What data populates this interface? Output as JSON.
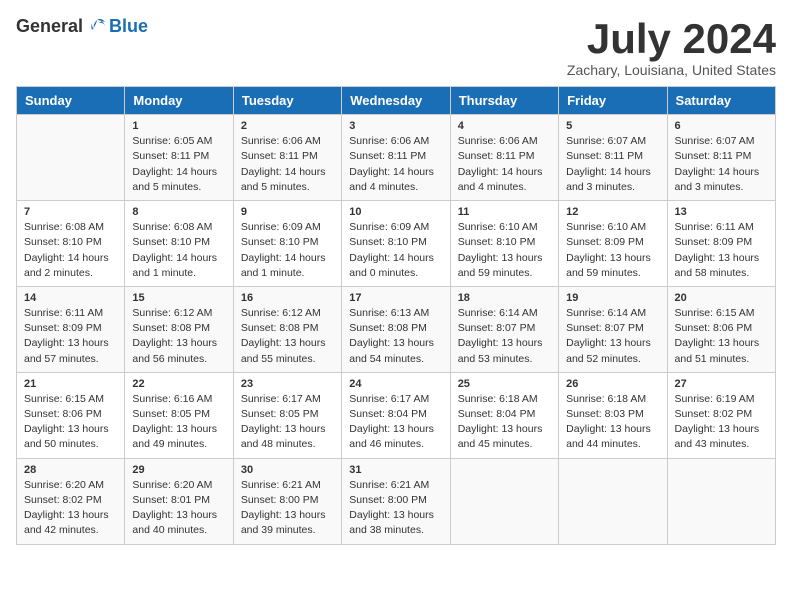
{
  "header": {
    "logo_general": "General",
    "logo_blue": "Blue",
    "month_title": "July 2024",
    "subtitle": "Zachary, Louisiana, United States"
  },
  "calendar": {
    "days_of_week": [
      "Sunday",
      "Monday",
      "Tuesday",
      "Wednesday",
      "Thursday",
      "Friday",
      "Saturday"
    ],
    "weeks": [
      [
        {
          "day": "",
          "info": ""
        },
        {
          "day": "1",
          "info": "Sunrise: 6:05 AM\nSunset: 8:11 PM\nDaylight: 14 hours\nand 5 minutes."
        },
        {
          "day": "2",
          "info": "Sunrise: 6:06 AM\nSunset: 8:11 PM\nDaylight: 14 hours\nand 5 minutes."
        },
        {
          "day": "3",
          "info": "Sunrise: 6:06 AM\nSunset: 8:11 PM\nDaylight: 14 hours\nand 4 minutes."
        },
        {
          "day": "4",
          "info": "Sunrise: 6:06 AM\nSunset: 8:11 PM\nDaylight: 14 hours\nand 4 minutes."
        },
        {
          "day": "5",
          "info": "Sunrise: 6:07 AM\nSunset: 8:11 PM\nDaylight: 14 hours\nand 3 minutes."
        },
        {
          "day": "6",
          "info": "Sunrise: 6:07 AM\nSunset: 8:11 PM\nDaylight: 14 hours\nand 3 minutes."
        }
      ],
      [
        {
          "day": "7",
          "info": "Sunrise: 6:08 AM\nSunset: 8:10 PM\nDaylight: 14 hours\nand 2 minutes."
        },
        {
          "day": "8",
          "info": "Sunrise: 6:08 AM\nSunset: 8:10 PM\nDaylight: 14 hours\nand 1 minute."
        },
        {
          "day": "9",
          "info": "Sunrise: 6:09 AM\nSunset: 8:10 PM\nDaylight: 14 hours\nand 1 minute."
        },
        {
          "day": "10",
          "info": "Sunrise: 6:09 AM\nSunset: 8:10 PM\nDaylight: 14 hours\nand 0 minutes."
        },
        {
          "day": "11",
          "info": "Sunrise: 6:10 AM\nSunset: 8:10 PM\nDaylight: 13 hours\nand 59 minutes."
        },
        {
          "day": "12",
          "info": "Sunrise: 6:10 AM\nSunset: 8:09 PM\nDaylight: 13 hours\nand 59 minutes."
        },
        {
          "day": "13",
          "info": "Sunrise: 6:11 AM\nSunset: 8:09 PM\nDaylight: 13 hours\nand 58 minutes."
        }
      ],
      [
        {
          "day": "14",
          "info": "Sunrise: 6:11 AM\nSunset: 8:09 PM\nDaylight: 13 hours\nand 57 minutes."
        },
        {
          "day": "15",
          "info": "Sunrise: 6:12 AM\nSunset: 8:08 PM\nDaylight: 13 hours\nand 56 minutes."
        },
        {
          "day": "16",
          "info": "Sunrise: 6:12 AM\nSunset: 8:08 PM\nDaylight: 13 hours\nand 55 minutes."
        },
        {
          "day": "17",
          "info": "Sunrise: 6:13 AM\nSunset: 8:08 PM\nDaylight: 13 hours\nand 54 minutes."
        },
        {
          "day": "18",
          "info": "Sunrise: 6:14 AM\nSunset: 8:07 PM\nDaylight: 13 hours\nand 53 minutes."
        },
        {
          "day": "19",
          "info": "Sunrise: 6:14 AM\nSunset: 8:07 PM\nDaylight: 13 hours\nand 52 minutes."
        },
        {
          "day": "20",
          "info": "Sunrise: 6:15 AM\nSunset: 8:06 PM\nDaylight: 13 hours\nand 51 minutes."
        }
      ],
      [
        {
          "day": "21",
          "info": "Sunrise: 6:15 AM\nSunset: 8:06 PM\nDaylight: 13 hours\nand 50 minutes."
        },
        {
          "day": "22",
          "info": "Sunrise: 6:16 AM\nSunset: 8:05 PM\nDaylight: 13 hours\nand 49 minutes."
        },
        {
          "day": "23",
          "info": "Sunrise: 6:17 AM\nSunset: 8:05 PM\nDaylight: 13 hours\nand 48 minutes."
        },
        {
          "day": "24",
          "info": "Sunrise: 6:17 AM\nSunset: 8:04 PM\nDaylight: 13 hours\nand 46 minutes."
        },
        {
          "day": "25",
          "info": "Sunrise: 6:18 AM\nSunset: 8:04 PM\nDaylight: 13 hours\nand 45 minutes."
        },
        {
          "day": "26",
          "info": "Sunrise: 6:18 AM\nSunset: 8:03 PM\nDaylight: 13 hours\nand 44 minutes."
        },
        {
          "day": "27",
          "info": "Sunrise: 6:19 AM\nSunset: 8:02 PM\nDaylight: 13 hours\nand 43 minutes."
        }
      ],
      [
        {
          "day": "28",
          "info": "Sunrise: 6:20 AM\nSunset: 8:02 PM\nDaylight: 13 hours\nand 42 minutes."
        },
        {
          "day": "29",
          "info": "Sunrise: 6:20 AM\nSunset: 8:01 PM\nDaylight: 13 hours\nand 40 minutes."
        },
        {
          "day": "30",
          "info": "Sunrise: 6:21 AM\nSunset: 8:00 PM\nDaylight: 13 hours\nand 39 minutes."
        },
        {
          "day": "31",
          "info": "Sunrise: 6:21 AM\nSunset: 8:00 PM\nDaylight: 13 hours\nand 38 minutes."
        },
        {
          "day": "",
          "info": ""
        },
        {
          "day": "",
          "info": ""
        },
        {
          "day": "",
          "info": ""
        }
      ]
    ]
  }
}
